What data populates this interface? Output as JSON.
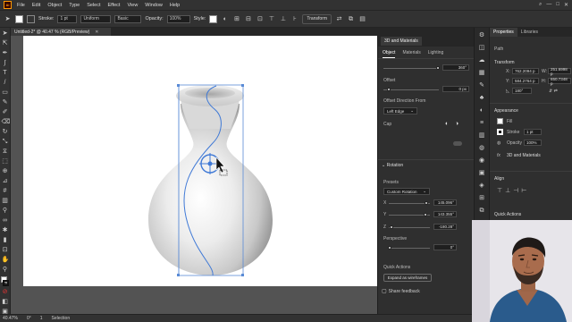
{
  "app": {
    "logo": "Ai"
  },
  "menu": [
    "File",
    "Edit",
    "Object",
    "Type",
    "Select",
    "Effect",
    "View",
    "Window",
    "Help"
  ],
  "control_bar": {
    "stroke_label": "Stroke:",
    "stroke_value": "1 pt",
    "profile": "Uniform",
    "brush": "Basic",
    "opacity_label": "Opacity:",
    "opacity_value": "100%",
    "style_label": "Style:",
    "transform_label": "Transform"
  },
  "document": {
    "tab_title": "Untitled-2* @ 40.47 % (RGB/Preview)"
  },
  "status": {
    "zoom": "40.47%",
    "rotation": "0°",
    "page": "1",
    "tool": "Selection"
  },
  "panel_3d": {
    "title": "3D and Materials",
    "tabs": [
      "Object",
      "Materials",
      "Lighting"
    ],
    "active_tab": "Object",
    "revolve_angle": "360°",
    "offset_label": "Offset",
    "offset_value": "0 px",
    "offset_direction_label": "Offset Direction From",
    "offset_direction_value": "Left Edge",
    "cap_label": "Cap",
    "rotation_label": "Rotation",
    "presets_label": "Presets",
    "presets_value": "Custom Rotation",
    "x_label": "X",
    "x_value": "145.096°",
    "y_label": "Y",
    "y_value": "143.355°",
    "z_label": "Z",
    "z_value": "-180.28°",
    "perspective_label": "Perspective",
    "perspective_value": "0°",
    "quick_actions_label": "Quick Actions",
    "expand_button": "Expand as wireframes",
    "feedback": "Share feedback"
  },
  "properties": {
    "tabs": [
      "Properties",
      "Libraries"
    ],
    "path_label": "Path",
    "transform_label": "Transform",
    "x_label": "X:",
    "x_value": "762.2094 p",
    "y_label": "Y:",
    "y_value": "584.2764 p",
    "w_label": "W:",
    "w_value": "251.6998 p",
    "h_label": "H:",
    "h_value": "650.7348 p",
    "angle_value": "180°",
    "appearance_label": "Appearance",
    "fill_label": "Fill",
    "stroke_label": "Stroke",
    "stroke_value": "1 pt",
    "opacity_label": "Opacity",
    "opacity_value": "100%",
    "fx_label": "fx",
    "effect_label": "3D and Materials",
    "align_label": "Align",
    "quick_actions_label": "Quick Actions"
  }
}
